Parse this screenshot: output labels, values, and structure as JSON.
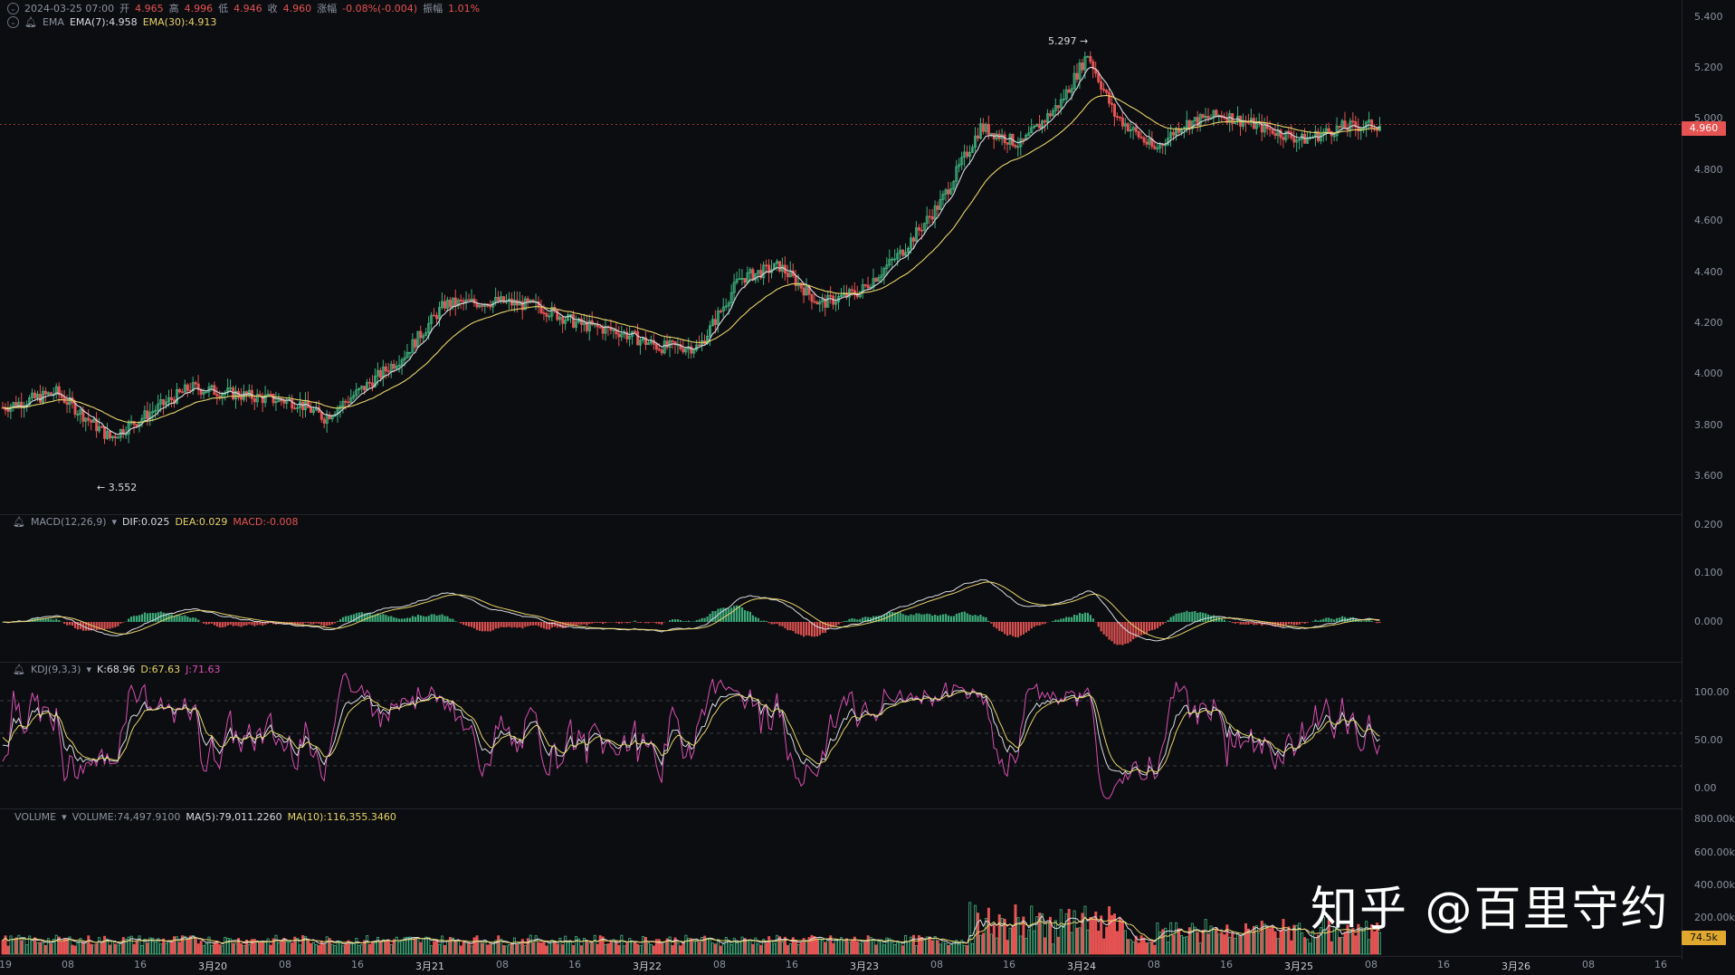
{
  "main_header": {
    "datetime": "2024-03-25 07:00",
    "open_label": "开",
    "open": "4.965",
    "high_label": "高",
    "high": "4.996",
    "low_label": "低",
    "low": "4.946",
    "close_label": "收",
    "close": "4.960",
    "change_label": "涨幅",
    "change": "-0.08%(-0.004)",
    "amplitude_label": "振幅",
    "amplitude": "1.01%"
  },
  "ema_header": {
    "name": "EMA",
    "ema7": "EMA(7):4.958",
    "ema30": "EMA(30):4.913"
  },
  "macd_header": {
    "name": "MACD(12,26,9)",
    "dif": "DIF:0.025",
    "dea": "DEA:0.029",
    "macd": "MACD:-0.008"
  },
  "kdj_header": {
    "name": "KDJ(9,3,3)",
    "k": "K:68.96",
    "d": "D:67.63",
    "j": "J:71.63"
  },
  "vol_header": {
    "name": "VOLUME",
    "volume": "VOLUME:74,497.9100",
    "ma5": "MA(5):79,011.2260",
    "ma10": "MA(10):116,355.3460"
  },
  "price_axis": [
    "5.400",
    "5.200",
    "5.000",
    "4.800",
    "4.600",
    "4.400",
    "4.200",
    "4.000",
    "3.800",
    "3.600"
  ],
  "macd_axis": [
    "0.200",
    "0.100",
    "0.000"
  ],
  "kdj_axis": [
    "100.00",
    "50.00",
    "0.00"
  ],
  "vol_axis": [
    "800.00k",
    "600.00k",
    "400.00k",
    "200.00k"
  ],
  "last_price_tag": "4.960",
  "last_volume_tag": "74.5k",
  "high_annotation": "5.297 →",
  "low_annotation": "← 3.552",
  "time_axis": [
    "19",
    "08",
    "16",
    "3月20",
    "08",
    "16",
    "3月21",
    "08",
    "16",
    "3月22",
    "08",
    "16",
    "3月23",
    "08",
    "16",
    "3月24",
    "08",
    "16",
    "3月25",
    "08",
    "16",
    "3月26",
    "08",
    "16"
  ],
  "watermark": "知乎 @百里守约",
  "colors": {
    "up": "#3fb27f",
    "down": "#e55353",
    "ema7": "#d8dbe2",
    "ema30": "#e6d36a",
    "j": "#d84fb3",
    "bg": "#0c0d10"
  },
  "chart_data": {
    "type": "candlestick",
    "interval": "1h",
    "y_range": [
      3.5,
      5.4
    ],
    "extremes": {
      "high": 5.297,
      "low": 3.552
    },
    "last": {
      "open": 4.965,
      "high": 4.996,
      "low": 4.946,
      "close": 4.96
    },
    "ema": {
      "ema7": 4.958,
      "ema30": 4.913
    },
    "macd": {
      "dif": 0.025,
      "dea": 0.029,
      "macd": -0.008
    },
    "kdj": {
      "k": 68.96,
      "d": 67.63,
      "j": 71.63
    },
    "volume": {
      "last": 74497.91,
      "ma5": 79011.226,
      "ma10": 116355.346
    }
  }
}
